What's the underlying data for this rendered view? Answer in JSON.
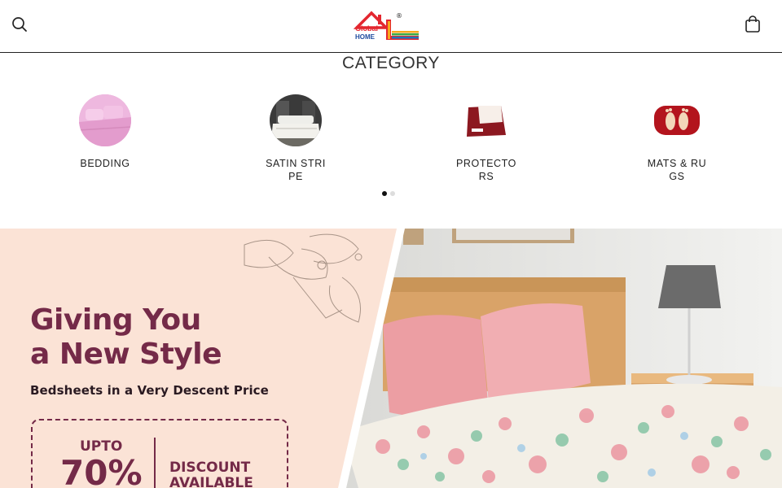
{
  "header": {
    "search_icon": "search-icon",
    "bag_icon": "shopping-bag-icon",
    "logo": {
      "line1": "Global",
      "line2": "HOME",
      "mark": "®"
    }
  },
  "category": {
    "title": "CATEGORY",
    "items": [
      {
        "label": "BEDDING",
        "thumb": "pink-bedding-image"
      },
      {
        "label": "SATIN STRIPE",
        "thumb": "satin-stripe-bed-image"
      },
      {
        "label": "PROTECTORS",
        "thumb": "maroon-protector-image"
      },
      {
        "label": "MATS & RUGS",
        "thumb": "red-mats-image"
      }
    ],
    "carousel": {
      "pages": 2,
      "active": 1
    }
  },
  "banner": {
    "headline_1": "Giving You",
    "headline_2": "a New Style",
    "subheading": "Bedsheets in a Very Descent Price",
    "offer_upto": "UPTO",
    "offer_percent": "70%",
    "offer_discount_1": "DISCOUNT",
    "offer_discount_2": "AVAILABLE",
    "colors": {
      "accent": "#742a48",
      "panel": "#fbe3d6"
    }
  }
}
